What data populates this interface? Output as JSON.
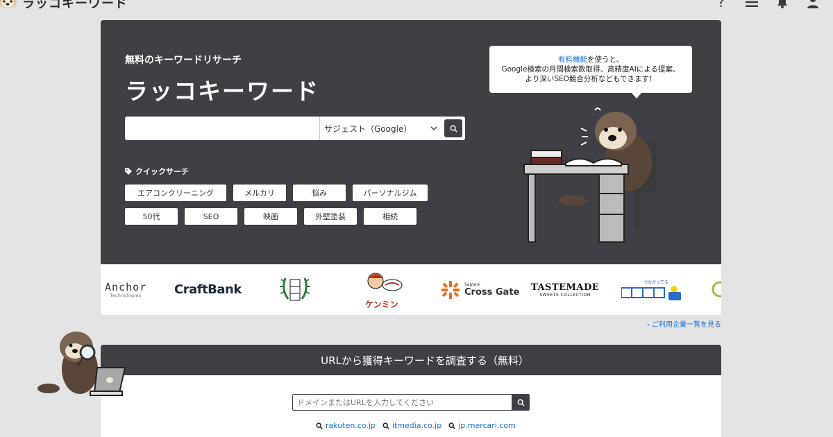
{
  "header": {
    "brand": "ラッコキーワード",
    "icons": [
      "help-icon",
      "menu-icon",
      "bell-icon",
      "user-icon"
    ],
    "help_glyph": "?"
  },
  "hero": {
    "subtitle": "無料のキーワードリサーチ",
    "title": "ラッコキーワード",
    "search": {
      "value": "",
      "placeholder": "",
      "mode_selected": "サジェスト（Google）"
    },
    "quick_search": {
      "label": "クイックサーチ",
      "row1": [
        "エアコンクリーニング",
        "メルカリ",
        "悩み",
        "パーソナルジム"
      ],
      "row2": [
        "50代",
        "SEO",
        "映画",
        "外壁塗装",
        "相続"
      ]
    },
    "bubble": {
      "link": "有料機能",
      "line1_rest": "を使うと、",
      "line2": "Google検索の月間検索数取得、高精度AIによる提案、",
      "line3": "より深いSEO競合分析などもできます！"
    }
  },
  "logos": {
    "anchor_big": "Anchor",
    "anchor_small": "Technologies",
    "craftbank": "CraftBank",
    "kenmin": "ケンミン",
    "cross_small": "Septeni",
    "cross_big": "Cross Gate",
    "tastemade_big": "TASTEMADE",
    "tastemade_small": "SWEETS COLLECTION",
    "home5_small": "つながってる"
  },
  "companies_link": "› ご利用企業一覧を見る",
  "url_section": {
    "heading": "URLから獲得キーワードを調査する（無料）",
    "placeholder": "ドメインまたはURLを入力してください",
    "examples": [
      "rakuten.co.jp",
      "itmedia.co.jp",
      "jp.mercari.com"
    ]
  },
  "colors": {
    "page_bg": "#e4e4e4",
    "panel_dark": "#3f3f45",
    "link_blue": "#1a6fd6"
  }
}
